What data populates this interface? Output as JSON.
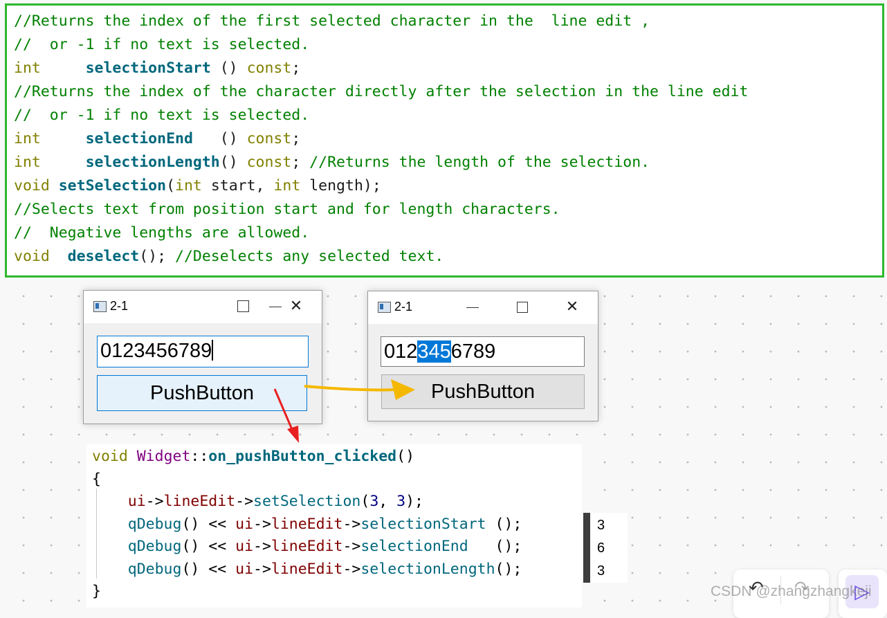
{
  "doc_lines": [
    [
      {
        "t": "//Returns the index of the first selected character in the  line edit ,",
        "c": "c-com"
      }
    ],
    [
      {
        "t": "//  or -1 if no text is selected.",
        "c": "c-com"
      }
    ],
    [
      {
        "t": "int",
        "c": "c-type"
      },
      {
        "t": "     ",
        "c": "c-plain"
      },
      {
        "t": "selectionStart",
        "c": "c-fn"
      },
      {
        "t": " () ",
        "c": "c-plain"
      },
      {
        "t": "const",
        "c": "c-type"
      },
      {
        "t": ";",
        "c": "c-plain"
      }
    ],
    [
      {
        "t": "//Returns the index of the character directly after the selection in the line edit",
        "c": "c-com"
      }
    ],
    [
      {
        "t": "//  or -1 if no text is selected.",
        "c": "c-com"
      }
    ],
    [
      {
        "t": "int",
        "c": "c-type"
      },
      {
        "t": "     ",
        "c": "c-plain"
      },
      {
        "t": "selectionEnd",
        "c": "c-fn"
      },
      {
        "t": "   () ",
        "c": "c-plain"
      },
      {
        "t": "const",
        "c": "c-type"
      },
      {
        "t": ";",
        "c": "c-plain"
      }
    ],
    [
      {
        "t": "int",
        "c": "c-type"
      },
      {
        "t": "     ",
        "c": "c-plain"
      },
      {
        "t": "selectionLength",
        "c": "c-fn"
      },
      {
        "t": "() ",
        "c": "c-plain"
      },
      {
        "t": "const",
        "c": "c-type"
      },
      {
        "t": "; ",
        "c": "c-plain"
      },
      {
        "t": "//Returns the length of the selection.",
        "c": "c-com"
      }
    ],
    [
      {
        "t": "void",
        "c": "c-type"
      },
      {
        "t": " ",
        "c": "c-plain"
      },
      {
        "t": "setSelection",
        "c": "c-fn"
      },
      {
        "t": "(",
        "c": "c-plain"
      },
      {
        "t": "int",
        "c": "c-type"
      },
      {
        "t": " start, ",
        "c": "c-plain"
      },
      {
        "t": "int",
        "c": "c-type"
      },
      {
        "t": " length);",
        "c": "c-plain"
      }
    ],
    [
      {
        "t": "//Selects text from position start and for length characters.",
        "c": "c-com"
      }
    ],
    [
      {
        "t": "//  Negative lengths are allowed.",
        "c": "c-com"
      }
    ],
    [
      {
        "t": "void",
        "c": "c-type"
      },
      {
        "t": "  ",
        "c": "c-plain"
      },
      {
        "t": "deselect",
        "c": "c-fn"
      },
      {
        "t": "(); ",
        "c": "c-plain"
      },
      {
        "t": "//Deselects any selected text.",
        "c": "c-com"
      }
    ]
  ],
  "window_left": {
    "title": "2-1",
    "line_edit_value": "0123456789",
    "button_label": "PushButton",
    "min_icon": "minimize-icon",
    "max_icon": "maximize-icon",
    "close_icon": "close-icon",
    "close_glyph": "✕"
  },
  "window_right": {
    "title": "2-1",
    "line_edit_before": "012",
    "line_edit_selected": "345",
    "line_edit_after": "6789",
    "button_label": "PushButton",
    "close_glyph": "✕"
  },
  "code_lines": [
    [
      {
        "t": "void",
        "c": "k-kw"
      },
      {
        "t": " ",
        "c": "k-op"
      },
      {
        "t": "Widget",
        "c": "k-cls"
      },
      {
        "t": "::",
        "c": "k-op"
      },
      {
        "t": "on_pushButton_clicked",
        "c": "k-fn"
      },
      {
        "t": "()",
        "c": "k-op"
      }
    ],
    [
      {
        "t": "{",
        "c": "k-op"
      }
    ],
    [
      {
        "t": "    ",
        "c": "k-op"
      },
      {
        "t": "ui",
        "c": "k-mem"
      },
      {
        "t": "->",
        "c": "k-op"
      },
      {
        "t": "lineEdit",
        "c": "k-mem"
      },
      {
        "t": "->",
        "c": "k-op"
      },
      {
        "t": "setSelection",
        "c": "k-call"
      },
      {
        "t": "(",
        "c": "k-op"
      },
      {
        "t": "3",
        "c": "k-num"
      },
      {
        "t": ", ",
        "c": "k-op"
      },
      {
        "t": "3",
        "c": "k-num"
      },
      {
        "t": ");",
        "c": "k-op"
      }
    ],
    [
      {
        "t": "    ",
        "c": "k-op"
      },
      {
        "t": "qDebug",
        "c": "k-call"
      },
      {
        "t": "() << ",
        "c": "k-op"
      },
      {
        "t": "ui",
        "c": "k-mem"
      },
      {
        "t": "->",
        "c": "k-op"
      },
      {
        "t": "lineEdit",
        "c": "k-mem"
      },
      {
        "t": "->",
        "c": "k-op"
      },
      {
        "t": "selectionStart",
        "c": "k-call"
      },
      {
        "t": " ();",
        "c": "k-op"
      }
    ],
    [
      {
        "t": "    ",
        "c": "k-op"
      },
      {
        "t": "qDebug",
        "c": "k-call"
      },
      {
        "t": "() << ",
        "c": "k-op"
      },
      {
        "t": "ui",
        "c": "k-mem"
      },
      {
        "t": "->",
        "c": "k-op"
      },
      {
        "t": "lineEdit",
        "c": "k-mem"
      },
      {
        "t": "->",
        "c": "k-op"
      },
      {
        "t": "selectionEnd",
        "c": "k-call"
      },
      {
        "t": "   ();",
        "c": "k-op"
      }
    ],
    [
      {
        "t": "    ",
        "c": "k-op"
      },
      {
        "t": "qDebug",
        "c": "k-call"
      },
      {
        "t": "() << ",
        "c": "k-op"
      },
      {
        "t": "ui",
        "c": "k-mem"
      },
      {
        "t": "->",
        "c": "k-op"
      },
      {
        "t": "lineEdit",
        "c": "k-mem"
      },
      {
        "t": "->",
        "c": "k-op"
      },
      {
        "t": "selectionLength",
        "c": "k-call"
      },
      {
        "t": "();",
        "c": "k-op"
      }
    ],
    [
      {
        "t": "}",
        "c": "k-op"
      }
    ]
  ],
  "console_output": [
    "3",
    "6",
    "3"
  ],
  "toolbar": {
    "undo_icon": "undo-icon",
    "undo_glyph": "↶",
    "redo_icon": "redo-icon",
    "redo_glyph": "↷",
    "cursor_icon": "cursor-icon",
    "cursor_glyph": "▷"
  },
  "watermark": "CSDN @zhangzhangkeji",
  "colors": {
    "frame_green": "#2eb82e",
    "arrow_orange": "#f5b800",
    "arrow_red": "#e82020",
    "selection_blue": "#0078d7"
  }
}
